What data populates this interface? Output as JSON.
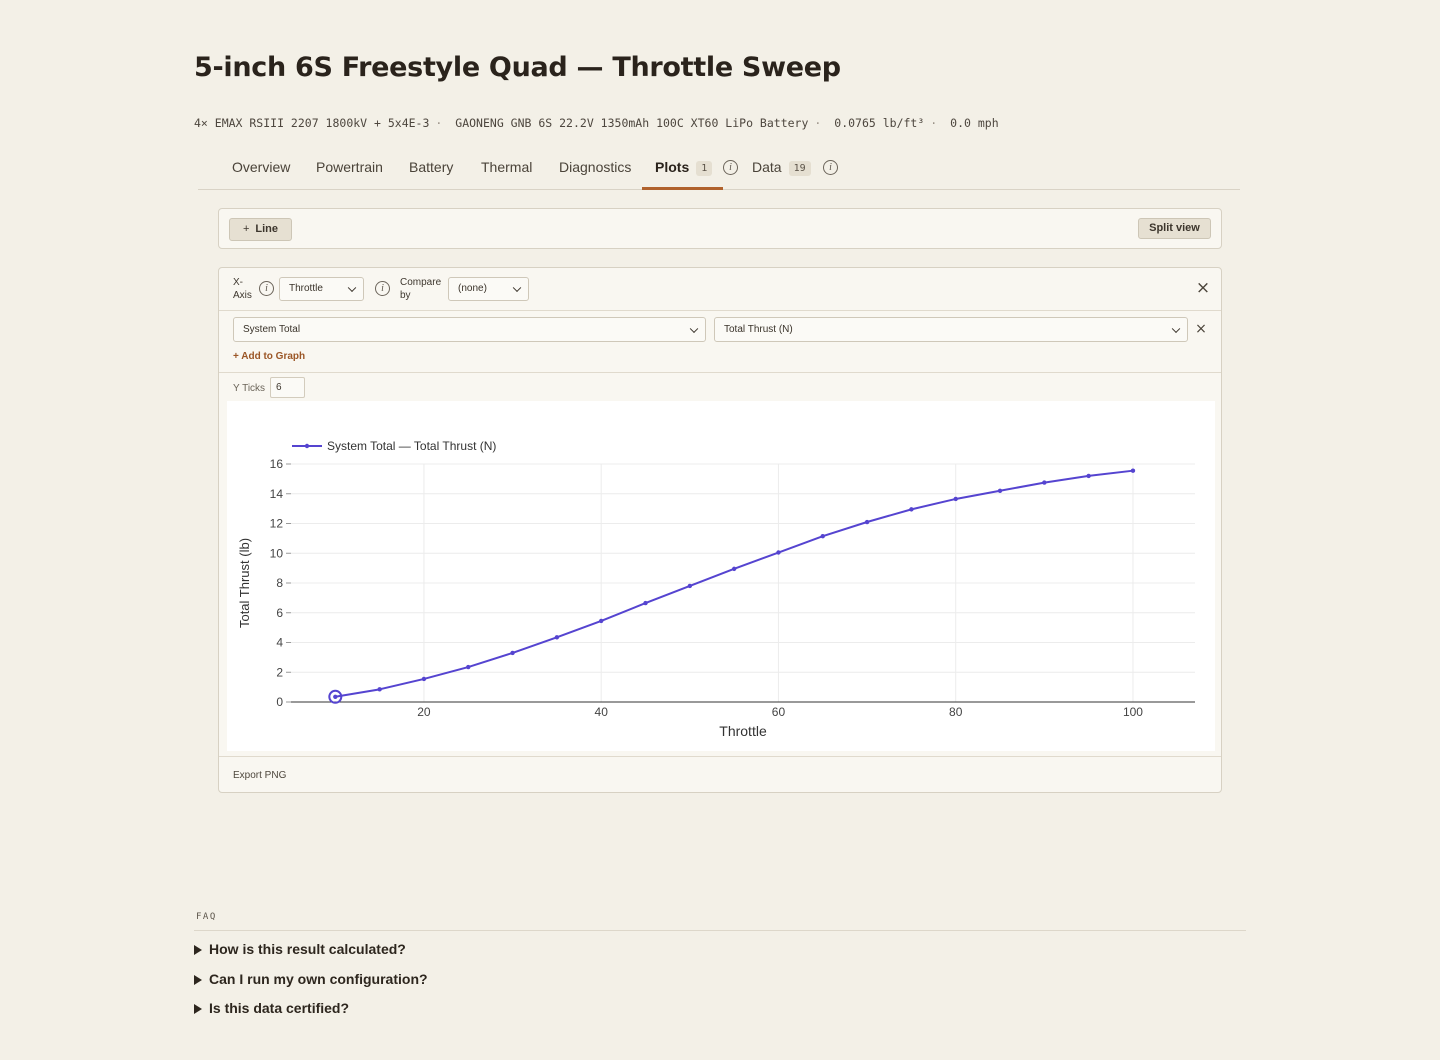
{
  "page": {
    "title": "5-inch 6S Freestyle Quad — Throttle Sweep",
    "specs": [
      "4× EMAX RSIII 2207 1800kV + 5x4E-3",
      "GAONENG GNB 6S 22.2V 1350mAh 100C XT60 LiPo Battery",
      "0.0765 lb/ft³",
      "0.0 mph"
    ]
  },
  "tabs": [
    {
      "label": "Overview"
    },
    {
      "label": "Powertrain"
    },
    {
      "label": "Battery"
    },
    {
      "label": "Thermal"
    },
    {
      "label": "Diagnostics"
    },
    {
      "label": "Plots",
      "badge": "1",
      "active": true
    },
    {
      "label": "Data",
      "badge": "19"
    }
  ],
  "toolbar": {
    "line_button": "Line",
    "split_button": "Split view"
  },
  "controls": {
    "x_axis_label": "X-Axis",
    "x_axis_value": "Throttle",
    "compare_label": "Compare by",
    "compare_value": "(none)",
    "series_source": "System Total",
    "series_metric": "Total Thrust (N)",
    "add_to_graph": "+ Add to Graph",
    "y_ticks_label": "Y Ticks",
    "y_ticks_value": "6",
    "export": "Export PNG"
  },
  "faq": {
    "label": "FAQ",
    "items": [
      "How is this result calculated?",
      "Can I run my own configuration?",
      "Is this data certified?"
    ]
  },
  "chart_data": {
    "type": "line",
    "xlabel": "Throttle",
    "ylabel": "Total Thrust (lb)",
    "xlim": [
      5,
      107
    ],
    "ylim": [
      0,
      16
    ],
    "xticks": [
      20,
      40,
      60,
      80,
      100
    ],
    "yticks": [
      0,
      2,
      4,
      6,
      8,
      10,
      12,
      14,
      16
    ],
    "grid": true,
    "legend": "top-left",
    "series": [
      {
        "name": "System Total — Total Thrust (N)",
        "color": "#5544d0",
        "x": [
          10,
          15,
          20,
          25,
          30,
          35,
          40,
          45,
          50,
          55,
          60,
          65,
          70,
          75,
          80,
          85,
          90,
          95,
          100
        ],
        "y": [
          0.35,
          0.85,
          1.55,
          2.35,
          3.3,
          4.35,
          5.45,
          6.65,
          7.8,
          8.95,
          10.05,
          11.15,
          12.1,
          12.95,
          13.65,
          14.2,
          14.75,
          15.2,
          15.55
        ]
      }
    ],
    "highlight_point": {
      "x": 10,
      "y": 0.35
    }
  }
}
